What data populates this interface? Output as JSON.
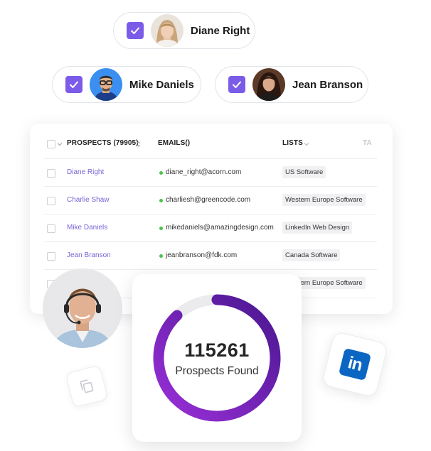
{
  "chips": [
    {
      "name": "Diane Right"
    },
    {
      "name": "Mike Daniels"
    },
    {
      "name": "Jean Branson"
    }
  ],
  "table": {
    "headers": {
      "prospects": "PROSPECTS (79905)",
      "emails": "EMAILS()",
      "lists": "LISTS",
      "tags": "TA"
    },
    "rows": [
      {
        "name": "Diane Right",
        "email": "diane_right@acorn.com",
        "list": "US Software"
      },
      {
        "name": "Charlie Shaw",
        "email": "charliesh@greencode.com",
        "list": "Western Europe Software"
      },
      {
        "name": "Mike Daniels",
        "email": "mikedaniels@amazingdesign.com",
        "list": "LinkedIn Web Design"
      },
      {
        "name": "Jean Branson",
        "email": "jeanbranson@fdk.com",
        "list": "Canada Software"
      },
      {
        "name": "",
        "email": "",
        "list": "Western Europe Software"
      }
    ]
  },
  "stats": {
    "count": "115261",
    "label": "Prospects Found",
    "progress_fraction": 0.88
  },
  "linkedin": {
    "glyph": "in"
  },
  "colors": {
    "accent": "#7b5ce8",
    "link": "#7a63d6",
    "ring_start": "#9a2fd8",
    "ring_end": "#4a1790",
    "linkedin": "#0a66c2",
    "status_dot": "#4cc24c"
  }
}
